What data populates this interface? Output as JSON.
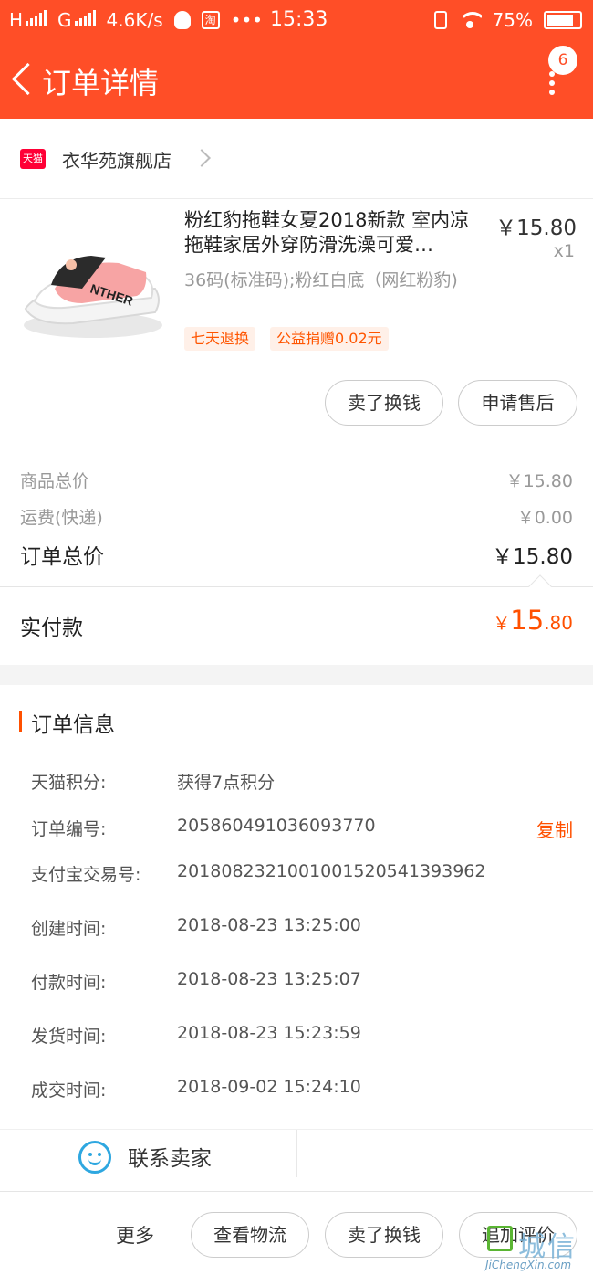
{
  "status_bar": {
    "carrier1": "H",
    "carrier2": "G",
    "speed": "4.6K/s",
    "taobao_label": "淘",
    "more": "•••",
    "time": "15:33",
    "battery": "75%"
  },
  "header": {
    "title": "订单详情",
    "notification_count": "6"
  },
  "shop": {
    "tmall_logo_text": "天猫",
    "name": "衣华苑旗舰店"
  },
  "product": {
    "title": "粉红豹拖鞋女夏2018新款 室内凉拖鞋家居外穿防滑洗澡可爱…",
    "price": "￥15.80",
    "quantity": "x1",
    "sku": "36码(标准码);粉红白底（网红粉豹)",
    "tags": [
      "七天退换",
      "公益捐赠0.02元"
    ],
    "actions": [
      "卖了换钱",
      "申请售后"
    ]
  },
  "summary": {
    "goods_total_label": "商品总价",
    "goods_total": "￥15.80",
    "shipping_label": "运费(快递)",
    "shipping": "￥0.00",
    "order_total_label": "订单总价",
    "order_total": "￥15.80",
    "paid_label": "实付款",
    "paid_currency": "￥",
    "paid_int": "15",
    "paid_dec": ".80"
  },
  "order_info": {
    "heading": "订单信息",
    "rows": [
      {
        "label": "天猫积分:",
        "value": "获得7点积分"
      },
      {
        "label": "订单编号:",
        "value": "205860491036093770"
      },
      {
        "label": "支付宝交易号:",
        "value": "2018082321001001520541393962"
      },
      {
        "label": "创建时间:",
        "value": "2018-08-23 13:25:00"
      },
      {
        "label": "付款时间:",
        "value": "2018-08-23 13:25:07"
      },
      {
        "label": "发货时间:",
        "value": "2018-08-23 15:23:59"
      },
      {
        "label": "成交时间:",
        "value": "2018-09-02 15:24:10"
      }
    ],
    "copy_label": "复制"
  },
  "contact": {
    "label": "联系卖家"
  },
  "bottom_bar": {
    "more": "更多",
    "buttons": [
      "查看物流",
      "卖了换钱",
      "追加评价"
    ]
  },
  "watermark": {
    "text": "城信",
    "sub": "JiChengXin.com"
  },
  "colors": {
    "brand": "#ff4e27",
    "accent": "#ff5000",
    "tmall": "#ff0036"
  }
}
